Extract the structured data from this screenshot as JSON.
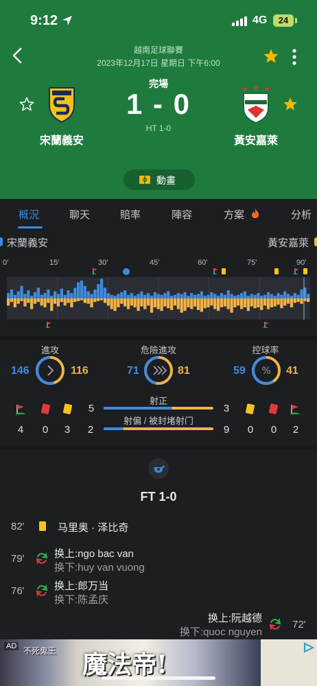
{
  "status_bar": {
    "time": "9:12",
    "network": "4G",
    "battery": "24"
  },
  "match": {
    "league": "越南足球聯賽",
    "datetime": "2023年12月17日 星期日 下午6:00",
    "status": "完場",
    "score": "1 - 0",
    "half_time": "HT 1-0",
    "home_team": "宋蘭義安",
    "away_team": "黃安嘉萊",
    "animation_label": "動畫"
  },
  "tabs": [
    {
      "label": "概況",
      "active": true
    },
    {
      "label": "聊天"
    },
    {
      "label": "賠率"
    },
    {
      "label": "陣容"
    },
    {
      "label": "方案"
    },
    {
      "label": "分析"
    }
  ],
  "timeline": {
    "ticks": [
      "0'",
      "15'",
      "30'",
      "45'",
      "60'",
      "75'",
      "90'"
    ],
    "home_pressure": [
      6,
      10,
      4,
      8,
      14,
      5,
      9,
      3,
      7,
      12,
      4,
      6,
      10,
      3,
      8,
      5,
      11,
      4,
      9,
      6,
      12,
      18,
      20,
      14,
      8,
      5,
      10,
      16,
      22,
      12,
      6,
      4,
      3,
      5,
      7,
      9,
      4,
      6,
      3,
      5,
      8,
      4,
      6,
      3,
      7,
      5,
      4,
      6,
      8,
      3,
      4,
      6,
      5,
      7,
      3,
      6,
      4,
      5,
      8,
      3,
      4,
      7,
      5,
      3,
      6,
      4,
      9,
      5,
      3,
      4,
      6,
      8,
      3,
      5,
      4,
      6,
      3,
      4,
      7,
      5,
      3,
      6,
      4,
      8,
      5,
      3,
      6,
      4,
      10,
      12,
      5
    ],
    "away_pressure": [
      8,
      4,
      10,
      6,
      3,
      9,
      5,
      12,
      6,
      4,
      8,
      10,
      5,
      14,
      6,
      9,
      4,
      8,
      5,
      10,
      4,
      3,
      2,
      5,
      6,
      10,
      4,
      3,
      2,
      5,
      8,
      12,
      14,
      10,
      6,
      9,
      12,
      8,
      10,
      14,
      9,
      12,
      8,
      16,
      10,
      12,
      14,
      9,
      11,
      13,
      8,
      12,
      16,
      14,
      10,
      12,
      9,
      13,
      15,
      11,
      10,
      8,
      12,
      14,
      10,
      9,
      12,
      16,
      10,
      8,
      12,
      10,
      14,
      9,
      11,
      10,
      13,
      8,
      12,
      10,
      9,
      7,
      11,
      8,
      6,
      10,
      5,
      4,
      6,
      3,
      4
    ]
  },
  "stats": {
    "attack": {
      "title": "進攻",
      "home": "146",
      "away": "116",
      "home_value": 146,
      "away_value": 116
    },
    "dangerous_attack": {
      "title": "危險進攻",
      "home": "71",
      "away": "81",
      "home_value": 71,
      "away_value": 81
    },
    "possession": {
      "title": "控球率",
      "home": "59",
      "away": "41",
      "home_value": 59,
      "away_value": 41
    },
    "shots_on_target": {
      "label": "射正",
      "home": "5",
      "away": "3",
      "home_value": 5,
      "away_value": 3
    },
    "shots_off": {
      "label": "射偏 / 被封堵射门",
      "home": "2",
      "away": "9",
      "home_value": 2,
      "away_value": 9
    },
    "home_corners": "4",
    "home_red": "0",
    "home_yellow": "3",
    "away_yellow": "0",
    "away_red": "0",
    "away_corners": "2"
  },
  "events": {
    "final": "FT 1-0",
    "items": [
      {
        "minute": "82'",
        "text": "马里奥 · 泽比奇"
      },
      {
        "minute": "79'",
        "in": "换上:ngo bac van",
        "out": "换下:huy van vuong"
      },
      {
        "minute": "76'",
        "in": "换上:郎万当",
        "out": "换下:陈孟庆"
      },
      {
        "minute": "72'",
        "in": "换上:阮越德",
        "out": "换下:quoc nguyen"
      }
    ]
  },
  "ad": {
    "tag": "AD",
    "title": "魔法帝!",
    "subtitle": "不死鬼王"
  },
  "colors": {
    "header": "#1f7a3e",
    "home": "#3d8be0",
    "away": "#f0b24a",
    "star": "#f5b800"
  }
}
